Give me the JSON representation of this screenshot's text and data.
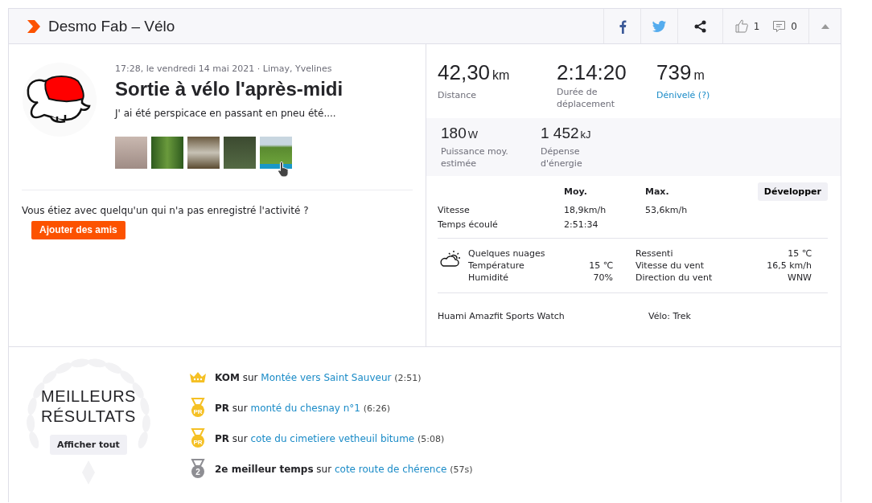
{
  "header": {
    "title": "Desmo Fab – Vélo",
    "kudos_count": "1",
    "comment_count": "0"
  },
  "activity": {
    "meta": "17:28, le vendredi 14 mai 2021 · Limay, Yvelines",
    "title": "Sortie à vélo l'après-midi",
    "description": "J' ai été perspicace en passant en pneu été....",
    "photos": [
      {
        "selected": false
      },
      {
        "selected": false
      },
      {
        "selected": false
      },
      {
        "selected": false
      },
      {
        "selected": true
      }
    ]
  },
  "friends": {
    "prompt": "Vous étiez avec quelqu'un qui n'a pas enregistré l'activité ?",
    "button": "Ajouter des amis"
  },
  "stats": {
    "primary": [
      {
        "value": "42,30",
        "unit": "km",
        "label": "Distance",
        "kind": "plain"
      },
      {
        "value": "2:14:20",
        "label": "Durée de déplacement",
        "kind": "plain"
      },
      {
        "value": "739",
        "unit": "m",
        "label": "Dénivelé (?)",
        "kind": "link"
      }
    ],
    "secondary": [
      {
        "value": "180",
        "unit": "W",
        "label": "Puissance moy. estimée",
        "kind": "plain"
      },
      {
        "value": "1 452",
        "unit": "kJ",
        "label": "Dépense d'énergie",
        "kind": "plain"
      }
    ]
  },
  "splits": {
    "columns": [
      "Moy.",
      "Max."
    ],
    "button": "Développer",
    "rows": [
      {
        "label": "Vitesse",
        "values": [
          "18,9km/h",
          "53,6km/h"
        ]
      },
      {
        "label": "Temps écoulé",
        "values": [
          "2:51:34"
        ]
      }
    ]
  },
  "weather": {
    "condition": "Quelques nuages",
    "left": [
      {
        "label": "Température",
        "value": "15 ℃"
      },
      {
        "label": "Humidité",
        "value": "70%"
      }
    ],
    "right": [
      {
        "label": "Ressenti",
        "value": "15 ℃"
      },
      {
        "label": "Vitesse du vent",
        "value": "16,5 km/h"
      },
      {
        "label": "Direction du vent",
        "value": "WNW"
      }
    ]
  },
  "device": "Huami Amazfit Sports Watch",
  "bike": "Vélo: Trek",
  "achievements": {
    "title": "MEILLEURS RÉSULTATS",
    "button": "Afficher tout",
    "items": [
      {
        "kind": "kom",
        "type": "KOM",
        "connector": "sur",
        "segment": "Montée vers Saint Sauveur",
        "time": "(2:51)"
      },
      {
        "kind": "pr",
        "badge": "PR",
        "type": "PR",
        "connector": "sur",
        "segment": "monté du chesnay n°1",
        "time": "(6:26)"
      },
      {
        "kind": "pr",
        "badge": "PR",
        "type": "PR",
        "connector": "sur",
        "segment": "cote du cimetiere vetheuil bitume",
        "time": "(5:08)"
      },
      {
        "kind": "rank",
        "badge": "2",
        "type": "2e meilleur temps",
        "connector": "sur",
        "segment": "cote route de chérence",
        "time": "(57s)"
      }
    ]
  }
}
